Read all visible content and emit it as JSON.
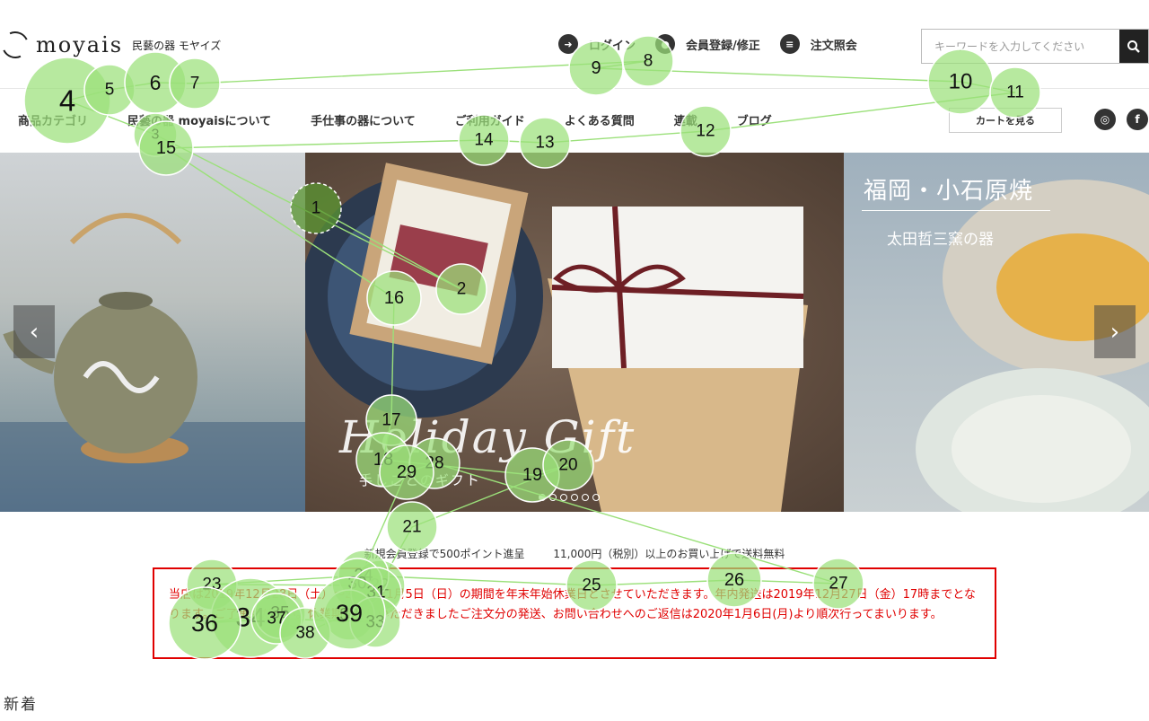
{
  "brand": {
    "logo_text": "moyais",
    "subtitle": "民藝の器 モヤイズ"
  },
  "top_links": [
    {
      "label": "ログイン",
      "icon": "login-icon"
    },
    {
      "label": "会員登録/修正",
      "icon": "user-icon"
    },
    {
      "label": "注文照会",
      "icon": "list-icon"
    }
  ],
  "search": {
    "placeholder": "キーワードを入力してください"
  },
  "nav": [
    "商品カテゴリ",
    "民藝の器 moyaisについて",
    "手仕事の器について",
    "ご利用ガイド",
    "よくある質問",
    "連載",
    "ブログ"
  ],
  "cart_label": "カートを見る",
  "carousel": {
    "main_title": "Holiday Gift",
    "main_sub": "手しごとのギフト",
    "right_title": "福岡・小石原焼",
    "right_sub": "太田哲三窯の器",
    "slide_count": 6,
    "active_slide": 1
  },
  "promo": [
    "新規会員登録で500ポイント進呈",
    "11,000円（税別）以上のお買い上げで送料無料"
  ],
  "notice": "当店は2019年12月28日（土）～2020年1月5日（日）の期間を年末年始休業日とさせていただきます。年内発送は2019年12月27日（金）17時までとなります。ご了承ください。休業期間中にいただきましたご注文分の発送、お問い合わせへのご返信は2020年1月6日(月)より順次行ってまいります。",
  "new_heading": "新着",
  "gaze_points": [
    "1",
    "2",
    "3",
    "4",
    "5",
    "6",
    "7",
    "8",
    "9",
    "10",
    "11",
    "12",
    "13",
    "14",
    "15",
    "16",
    "17",
    "18",
    "19",
    "20",
    "21",
    "22",
    "23",
    "24",
    "25",
    "26",
    "27",
    "28",
    "29",
    "30",
    "31",
    "32",
    "33",
    "34",
    "35",
    "36",
    "37",
    "38",
    "39"
  ],
  "colors": {
    "gaze": "#9be07a",
    "notice": "#e00000"
  }
}
